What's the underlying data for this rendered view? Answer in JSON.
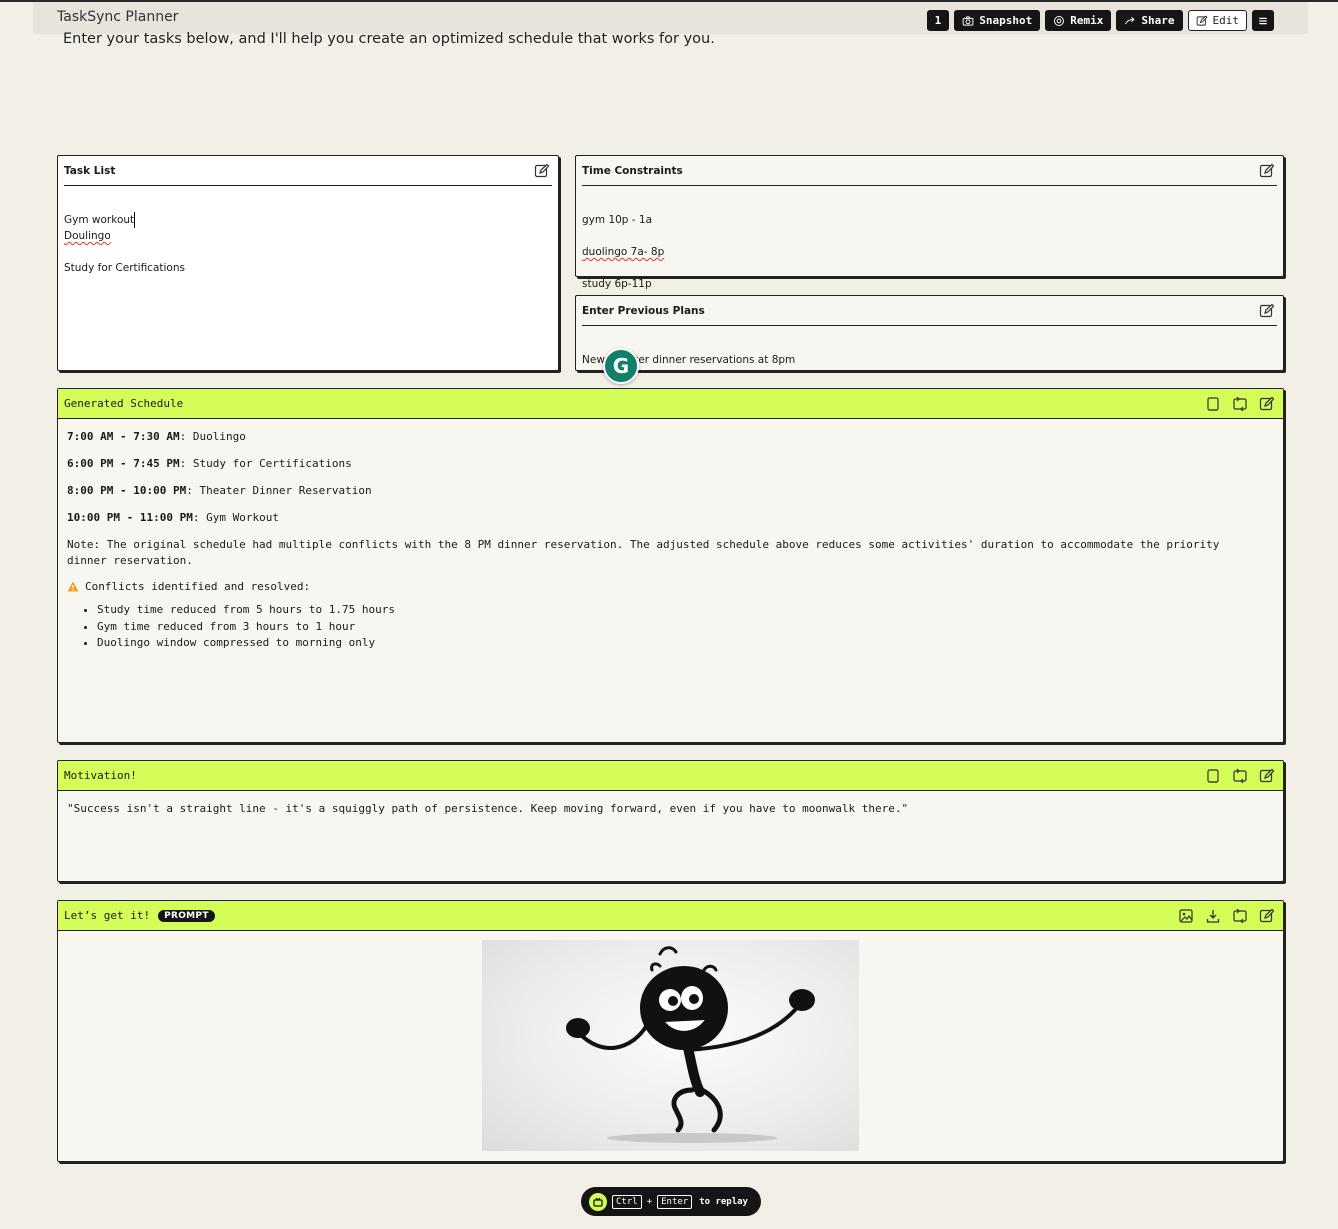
{
  "app": {
    "title": "TaskSync Planner",
    "subtitle": "Enter your tasks below, and I'll help you create an optimized schedule that works for you."
  },
  "toolbar": {
    "count": "1",
    "snapshot": "Snapshot",
    "remix": "Remix",
    "share": "Share",
    "edit": "Edit"
  },
  "task_list": {
    "title": "Task List",
    "lines": [
      "Gym workout",
      "Doulingo",
      "Study for Certifications"
    ]
  },
  "time_constraints": {
    "title": "Time Constraints",
    "lines": [
      "gym 10p - 1a",
      "duolingo 7a- 8p",
      "study 6p-11p"
    ]
  },
  "previous_plans": {
    "title": "Enter Previous Plans",
    "text": "New Theater dinner reservations at 8pm"
  },
  "schedule": {
    "title": "Generated Schedule",
    "items": [
      {
        "time": "7:00 AM - 7:30 AM",
        "task": ": Duolingo"
      },
      {
        "time": "6:00 PM - 7:45 PM",
        "task": ": Study for Certifications"
      },
      {
        "time": "8:00 PM - 10:00 PM",
        "task": ": Theater Dinner Reservation"
      },
      {
        "time": "10:00 PM - 11:00 PM",
        "task": ": Gym Workout"
      }
    ],
    "note": "Note: The original schedule had multiple conflicts with the 8 PM dinner reservation. The adjusted schedule above reduces some activities' duration to accommodate the priority dinner reservation.",
    "conflicts_heading": "Conflicts identified and resolved:",
    "conflicts": [
      "Study time reduced from 5 hours to 1.75 hours",
      "Gym time reduced from 3 hours to 1 hour",
      "Duolingo window compressed to morning only"
    ],
    "warning_color": "#f0a020"
  },
  "motivation": {
    "title": "Motivation!",
    "quote": "\"Success isn't a straight line - it's a squiggly path of persistence. Keep moving forward, even if you have to moonwalk there.\""
  },
  "lets_get_it": {
    "title": "Let’s get it!",
    "badge": "PROMPT"
  },
  "grammarly": {
    "letter": "G",
    "color": "#11806a"
  },
  "replay": {
    "key1": "Ctrl",
    "plus": "+",
    "key2": "Enter",
    "text": "to replay"
  },
  "colors": {
    "accent": "#d4fd57",
    "background": "#f1efe6",
    "dark": "#151515"
  }
}
